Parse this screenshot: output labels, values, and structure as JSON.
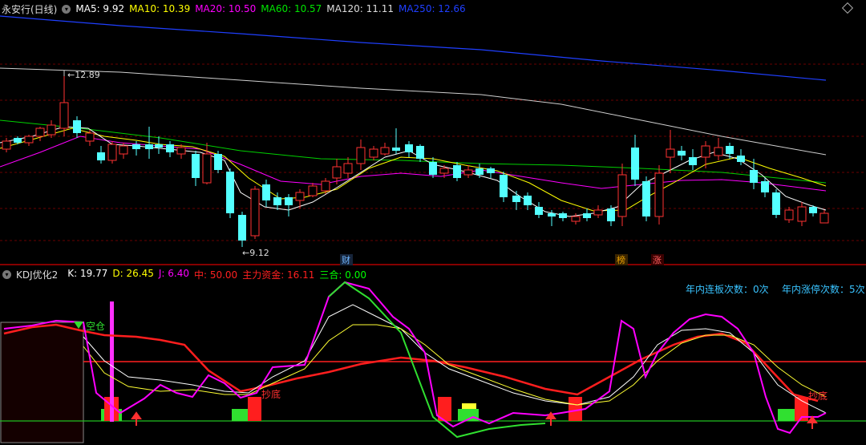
{
  "header": {
    "stock_title": "永安行(日线)",
    "ma": [
      {
        "label": "MA5: 9.92",
        "color": "#ffffff"
      },
      {
        "label": "MA10: 10.39",
        "color": "#ffff00"
      },
      {
        "label": "MA20: 10.50",
        "color": "#ff00ff"
      },
      {
        "label": "MA60: 10.57",
        "color": "#00e600"
      },
      {
        "label": "MA120: 11.11",
        "color": "#dddddd"
      },
      {
        "label": "MA250: 12.66",
        "color": "#1f3fff"
      }
    ]
  },
  "price_panel": {
    "high_label": "12.89",
    "low_label": "9.12",
    "markers": [
      {
        "text": "财",
        "color": "#6fb6ff",
        "bg": "#16243a"
      },
      {
        "text": "榜",
        "color": "#e8a000",
        "bg": "#3a2400"
      },
      {
        "text": "涨",
        "color": "#ff6060",
        "bg": "#3a0000"
      }
    ]
  },
  "indicator": {
    "name": "KDJ优化2",
    "values": [
      {
        "label": "K: 19.77",
        "color": "#ffffff"
      },
      {
        "label": "D: 26.45",
        "color": "#ffff00"
      },
      {
        "label": "J: 6.40",
        "color": "#ff00ff"
      },
      {
        "label": "中: 50.00",
        "color": "#ff2020"
      },
      {
        "label": "主力资金: 16.11",
        "color": "#ff2020"
      },
      {
        "label": "三合: 0.00",
        "color": "#00ff00"
      }
    ],
    "annotations": {
      "empty_pos": "空仓",
      "bottom_fish": "抄底"
    },
    "stats": {
      "limit_up_consecutive": "年内连板次数：0次",
      "limit_up_count": "年内涨停次数：5次"
    }
  },
  "colors": {
    "up": "#ff3232",
    "down": "#54ffff",
    "background": "#000000",
    "grid": "#7a0000"
  }
}
